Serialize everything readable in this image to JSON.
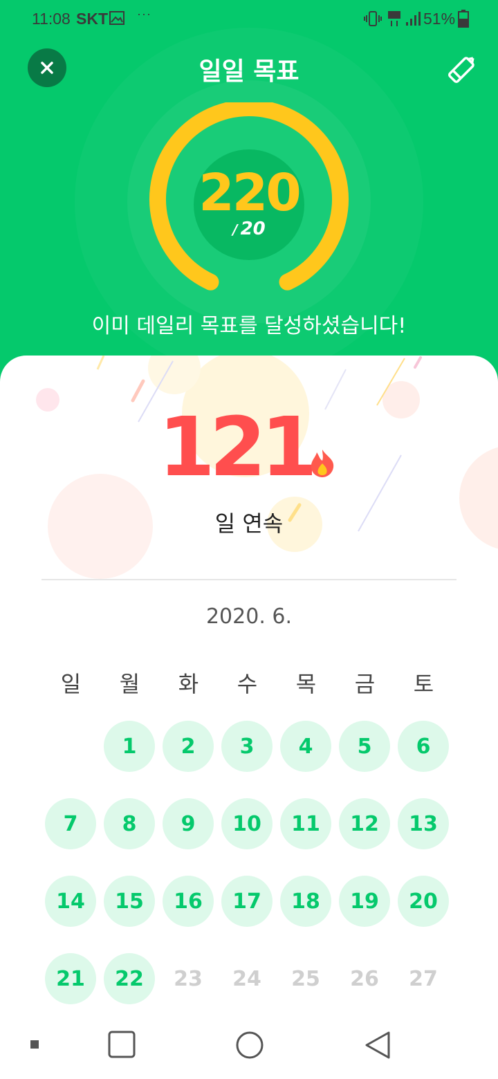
{
  "status_bar": {
    "time": "11:08",
    "carrier": "SKT",
    "more": "···",
    "battery_percent": "51%",
    "icons": [
      "gallery-icon",
      "vibrate-icon",
      "lte-icon",
      "signal-icon",
      "battery-icon"
    ]
  },
  "header": {
    "title": "일일 목표",
    "close_icon": "close-icon",
    "edit_icon": "pencil-icon"
  },
  "goal": {
    "value": "220",
    "goal_slash": "/",
    "goal_target": "20",
    "message": "이미 데일리 목표를 달성하셨습니다!",
    "progress_fraction": 1.0
  },
  "streak": {
    "count": "121",
    "label": "일 연속",
    "icon": "flame-icon"
  },
  "calendar": {
    "month_label": "2020. 6.",
    "weekdays": [
      "일",
      "월",
      "화",
      "수",
      "목",
      "금",
      "토"
    ],
    "leading_blank_days": 1,
    "days": [
      {
        "label": "1",
        "state": "done"
      },
      {
        "label": "2",
        "state": "done"
      },
      {
        "label": "3",
        "state": "done"
      },
      {
        "label": "4",
        "state": "done"
      },
      {
        "label": "5",
        "state": "done"
      },
      {
        "label": "6",
        "state": "done"
      },
      {
        "label": "7",
        "state": "done"
      },
      {
        "label": "8",
        "state": "done"
      },
      {
        "label": "9",
        "state": "done"
      },
      {
        "label": "10",
        "state": "done"
      },
      {
        "label": "11",
        "state": "done"
      },
      {
        "label": "12",
        "state": "done"
      },
      {
        "label": "13",
        "state": "done"
      },
      {
        "label": "14",
        "state": "done"
      },
      {
        "label": "15",
        "state": "done"
      },
      {
        "label": "16",
        "state": "done"
      },
      {
        "label": "17",
        "state": "done"
      },
      {
        "label": "18",
        "state": "done"
      },
      {
        "label": "19",
        "state": "done"
      },
      {
        "label": "20",
        "state": "done"
      },
      {
        "label": "21",
        "state": "done"
      },
      {
        "label": "22",
        "state": "done"
      },
      {
        "label": "23",
        "state": "future"
      },
      {
        "label": "24",
        "state": "future"
      },
      {
        "label": "25",
        "state": "future"
      },
      {
        "label": "26",
        "state": "future"
      },
      {
        "label": "27",
        "state": "future"
      }
    ]
  },
  "colors": {
    "brand_green": "#05C96C",
    "gauge_yellow": "#FFC71C",
    "streak_red": "#FF4E4E",
    "done_bg": "#DDF9EA",
    "future_text": "#CFCFCF"
  },
  "nav_bar": {
    "icons": [
      "nav-dot-icon",
      "recent-apps-icon",
      "home-icon",
      "back-icon"
    ]
  }
}
